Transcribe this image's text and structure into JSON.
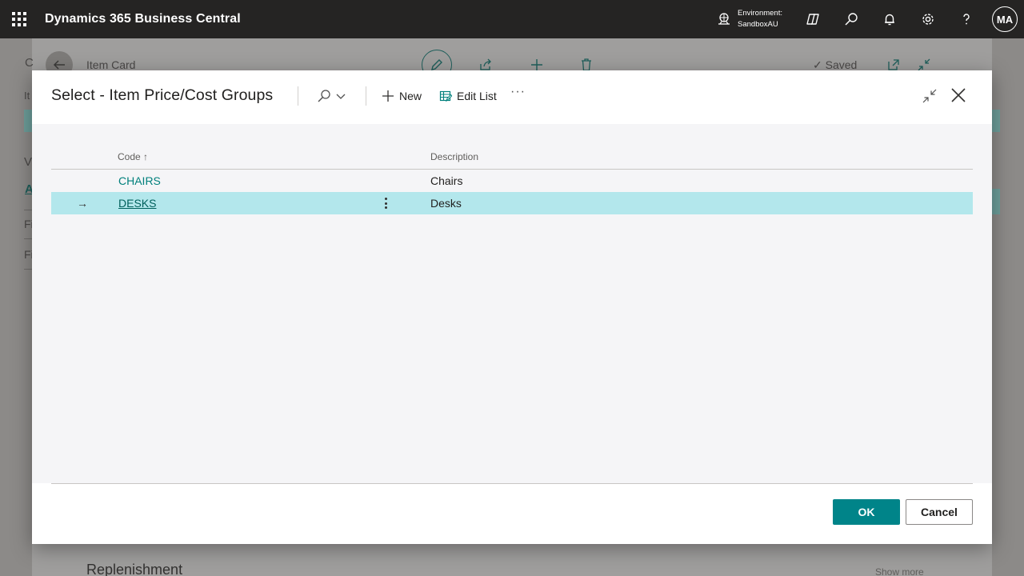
{
  "app": {
    "title": "Dynamics 365 Business Central",
    "environment_label": "Environment:",
    "environment_name": "SandboxAU",
    "user_initials": "MA"
  },
  "background_page": {
    "page_title": "Item Card",
    "saved_label": "Saved",
    "section_replenishment": "Replenishment",
    "show_more": "Show more",
    "side_fragments": [
      "C",
      "It",
      "V",
      "A",
      "Fi",
      "Fi"
    ]
  },
  "dialog": {
    "title": "Select - Item Price/Cost Groups",
    "actions": {
      "new_label": "New",
      "edit_list_label": "Edit List",
      "more_label": "···"
    },
    "columns": {
      "code": "Code",
      "code_sort_indicator": "↑",
      "description": "Description"
    },
    "rows": [
      {
        "code": "CHAIRS",
        "description": "Chairs",
        "selected": false
      },
      {
        "code": "DESKS",
        "description": "Desks",
        "selected": true
      }
    ],
    "selected_row_marker": "→",
    "footer": {
      "ok_label": "OK",
      "cancel_label": "Cancel"
    }
  },
  "colors": {
    "app_bar": "#252423",
    "accent": "#008489",
    "link": "#00807c",
    "selected_row": "#b3e7ec"
  }
}
